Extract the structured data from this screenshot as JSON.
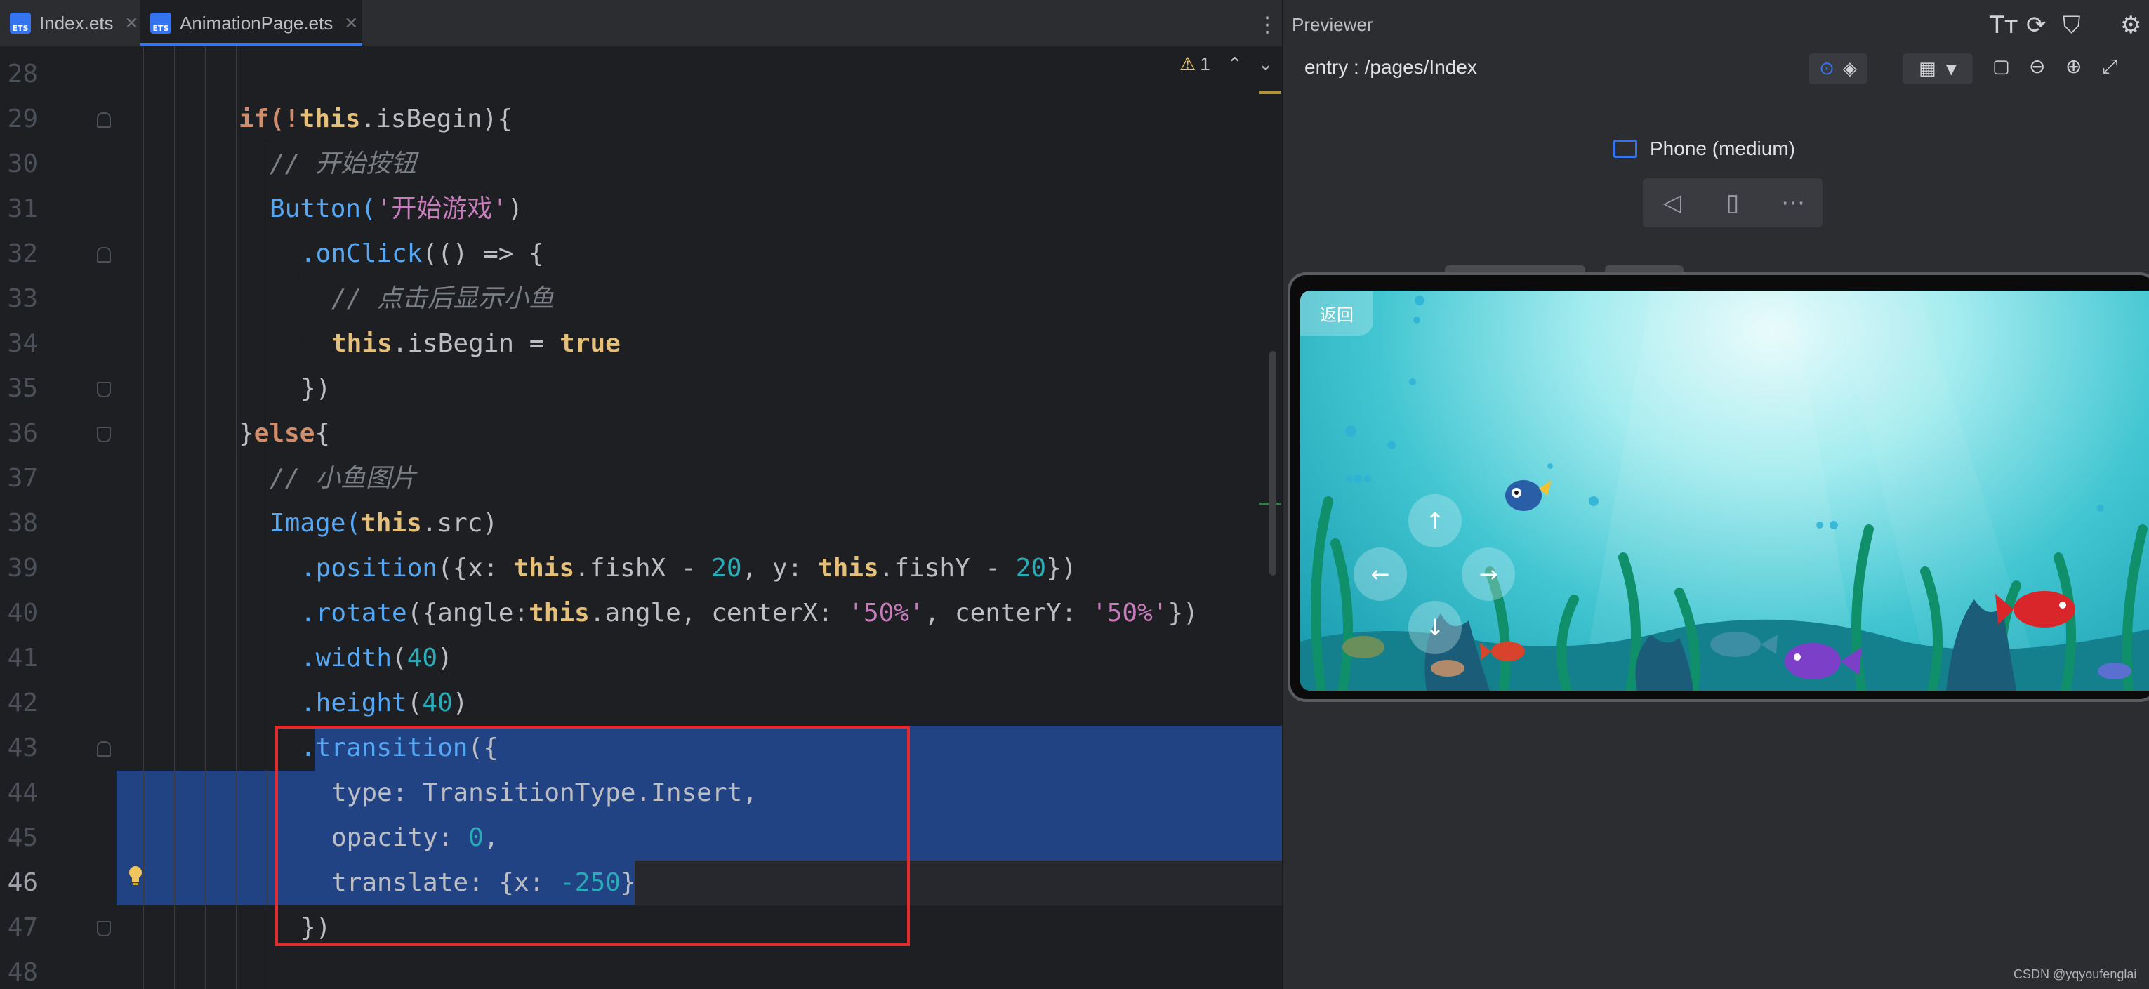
{
  "editor": {
    "tabs": [
      {
        "label": "Index.ets",
        "icon": "ets-file-icon",
        "active": false
      },
      {
        "label": "AnimationPage.ets",
        "icon": "ets-file-icon",
        "active": true
      }
    ],
    "warnings": "1",
    "lines": [
      {
        "n": "28"
      },
      {
        "n": "29"
      },
      {
        "n": "30"
      },
      {
        "n": "31"
      },
      {
        "n": "32"
      },
      {
        "n": "33"
      },
      {
        "n": "34"
      },
      {
        "n": "35"
      },
      {
        "n": "36"
      },
      {
        "n": "37"
      },
      {
        "n": "38"
      },
      {
        "n": "39"
      },
      {
        "n": "40"
      },
      {
        "n": "41"
      },
      {
        "n": "42"
      },
      {
        "n": "43"
      },
      {
        "n": "44"
      },
      {
        "n": "45"
      },
      {
        "n": "46"
      },
      {
        "n": "47"
      },
      {
        "n": "48"
      }
    ],
    "code": {
      "l29": {
        "a": "if(!",
        "b": "this",
        "c": ".isBegin){"
      },
      "l30": "// 开始按钮",
      "l31": {
        "a": "Button(",
        "b": "'开始游戏'",
        "c": ")"
      },
      "l32": {
        "a": ".onClick",
        "b": "(() => {"
      },
      "l33": "// 点击后显示小鱼",
      "l34": {
        "a": "this",
        "b": ".isBegin = ",
        "c": "true"
      },
      "l35": "})",
      "l36": {
        "a": "}",
        "b": "else",
        "c": "{"
      },
      "l37": "// 小鱼图片",
      "l38": {
        "a": "Image(",
        "b": "this",
        "c": ".src)"
      },
      "l39": {
        "a": ".position",
        "b": "({x: ",
        "c": "this",
        "d": ".fishX - ",
        "e": "20",
        "f": ", y: ",
        "g": "this",
        "h": ".fishY - ",
        "i": "20",
        "j": "})"
      },
      "l40": {
        "a": ".rotate",
        "b": "({angle:",
        "c": "this",
        "d": ".angle, centerX: ",
        "e": "'50%'",
        "f": ", centerY: ",
        "g": "'50%'",
        "h": "})"
      },
      "l41": {
        "a": ".width",
        "b": "(",
        "c": "40",
        "d": ")"
      },
      "l42": {
        "a": ".height",
        "b": "(",
        "c": "40",
        "d": ")"
      },
      "l43": {
        "a": ".transition",
        "b": "({"
      },
      "l44": "type: TransitionType.Insert,",
      "l45": {
        "a": "opacity: ",
        "b": "0",
        "c": ","
      },
      "l46": {
        "a": "translate: {x: ",
        "b": "-250",
        "c": "}"
      },
      "l47": "})"
    }
  },
  "previewer": {
    "title": "Previewer",
    "route": "entry : /pages/Index",
    "device": "Phone (medium)",
    "screen": {
      "back_label": "返回",
      "controls": {
        "up": "↑",
        "left": "←",
        "right": "→",
        "down": "↓"
      }
    }
  },
  "watermark": "CSDN @yqyoufenglai",
  "colors": {
    "selection": "#214283",
    "accent": "#3574f0",
    "highlight_box": "#e8292c"
  }
}
